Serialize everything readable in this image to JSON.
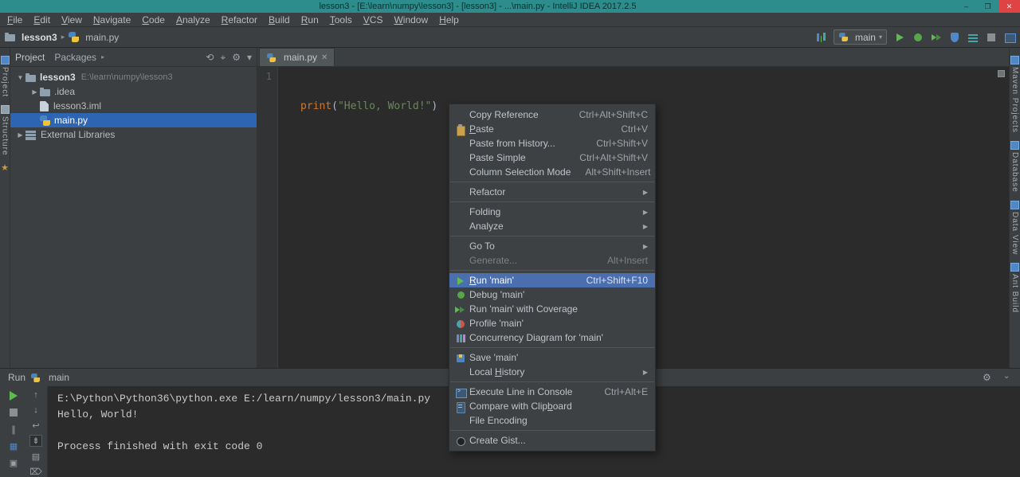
{
  "window": {
    "title": "lesson3 - [E:\\learn\\numpy\\lesson3] - [lesson3] - ...\\main.py - IntelliJ IDEA 2017.2.5",
    "minimize_glyph": "–",
    "maximize_glyph": "❐",
    "close_glyph": "✕"
  },
  "menubar": {
    "items": [
      {
        "label": "File",
        "u": 0
      },
      {
        "label": "Edit",
        "u": 0
      },
      {
        "label": "View",
        "u": 0
      },
      {
        "label": "Navigate",
        "u": 0
      },
      {
        "label": "Code",
        "u": 0
      },
      {
        "label": "Analyze",
        "u": 0
      },
      {
        "label": "Refactor",
        "u": 0
      },
      {
        "label": "Build",
        "u": 0
      },
      {
        "label": "Run",
        "u": 0
      },
      {
        "label": "Tools",
        "u": 0
      },
      {
        "label": "VCS",
        "u": 0
      },
      {
        "label": "Window",
        "u": 0
      },
      {
        "label": "Help",
        "u": 0
      }
    ]
  },
  "navbar": {
    "crumbs": [
      {
        "label": "lesson3"
      },
      {
        "label": "main.py"
      }
    ],
    "run_config": "main"
  },
  "project": {
    "header": {
      "title": "Project",
      "secondary": "Packages"
    },
    "tree": [
      {
        "label": "lesson3",
        "path": "E:\\learn\\numpy\\lesson3",
        "level": 0,
        "arrow": "down",
        "icon": "folder",
        "bold": true
      },
      {
        "label": ".idea",
        "level": 1,
        "arrow": "right",
        "icon": "folder"
      },
      {
        "label": "lesson3.iml",
        "level": 1,
        "icon": "file"
      },
      {
        "label": "main.py",
        "level": 1,
        "icon": "python",
        "selected": true
      },
      {
        "label": "External Libraries",
        "level": 0,
        "arrow": "right",
        "icon": "library"
      }
    ]
  },
  "editor": {
    "tab": {
      "label": "main.py"
    },
    "lines": [
      {
        "num": "1",
        "tokens": [
          {
            "t": "print",
            "c": "fn"
          },
          {
            "t": "(",
            "c": "pl"
          },
          {
            "t": "\"Hello, World!\"",
            "c": "st"
          },
          {
            "t": ")",
            "c": "pl"
          }
        ]
      }
    ]
  },
  "context_menu": {
    "items": [
      {
        "label": "Copy Reference",
        "shortcut": "Ctrl+Alt+Shift+C"
      },
      {
        "label": "Paste",
        "shortcut": "Ctrl+V",
        "icon": "paste",
        "u": 0
      },
      {
        "label": "Paste from History...",
        "shortcut": "Ctrl+Shift+V"
      },
      {
        "label": "Paste Simple",
        "shortcut": "Ctrl+Alt+Shift+V"
      },
      {
        "label": "Column Selection Mode",
        "shortcut": "Alt+Shift+Insert"
      },
      {
        "sep": true
      },
      {
        "label": "Refactor",
        "submenu": true
      },
      {
        "sep": true
      },
      {
        "label": "Folding",
        "submenu": true
      },
      {
        "label": "Analyze",
        "submenu": true
      },
      {
        "sep": true
      },
      {
        "label": "Go To",
        "submenu": true
      },
      {
        "label": "Generate...",
        "shortcut": "Alt+Insert",
        "disabled": true
      },
      {
        "sep": true
      },
      {
        "label": "Run 'main'",
        "shortcut": "Ctrl+Shift+F10",
        "icon": "run",
        "highlighted": true,
        "u": 0
      },
      {
        "label": "Debug 'main'",
        "icon": "debug"
      },
      {
        "label": "Run 'main' with Coverage",
        "icon": "coverage"
      },
      {
        "label": "Profile 'main'",
        "icon": "profile"
      },
      {
        "label": "Concurrency Diagram for 'main'",
        "icon": "concurrency"
      },
      {
        "sep": true
      },
      {
        "label": "Save 'main'",
        "icon": "save"
      },
      {
        "label": "Local History",
        "submenu": true,
        "u": 6
      },
      {
        "sep": true
      },
      {
        "label": "Execute Line in Console",
        "shortcut": "Ctrl+Alt+E",
        "icon": "execute"
      },
      {
        "label": "Compare with Clipboard",
        "icon": "compare",
        "u": 17
      },
      {
        "label": "File Encoding"
      },
      {
        "sep": true
      },
      {
        "label": "Create Gist...",
        "icon": "gist"
      }
    ]
  },
  "run_panel": {
    "label": "Run",
    "config": "main",
    "console": [
      "E:\\Python\\Python36\\python.exe E:/learn/numpy/lesson3/main.py",
      "Hello, World!",
      "",
      "Process finished with exit code 0"
    ]
  },
  "left_stripe": {
    "items": [
      {
        "label": "Project",
        "icon": "project"
      },
      {
        "label": "Structure",
        "icon": "structure"
      },
      {
        "label": "Favorites",
        "icon": "star",
        "icon_only": true
      }
    ]
  },
  "right_stripe": {
    "items": [
      {
        "label": "Maven Projects",
        "icon": "maven"
      },
      {
        "label": "Database",
        "icon": "database"
      },
      {
        "label": "Data View",
        "icon": "dataview"
      },
      {
        "label": "Ant Build",
        "icon": "ant"
      }
    ]
  },
  "colors": {
    "titlebar": "#2d8c8c",
    "selection_blue": "#2d65b2",
    "menu_highlight": "#4b6eaf",
    "run_green": "#5fbb4e",
    "editor_bg": "#2b2b2b",
    "panel_bg": "#3c3f41",
    "string_green": "#6a8759",
    "keyword_orange": "#cc7832"
  }
}
